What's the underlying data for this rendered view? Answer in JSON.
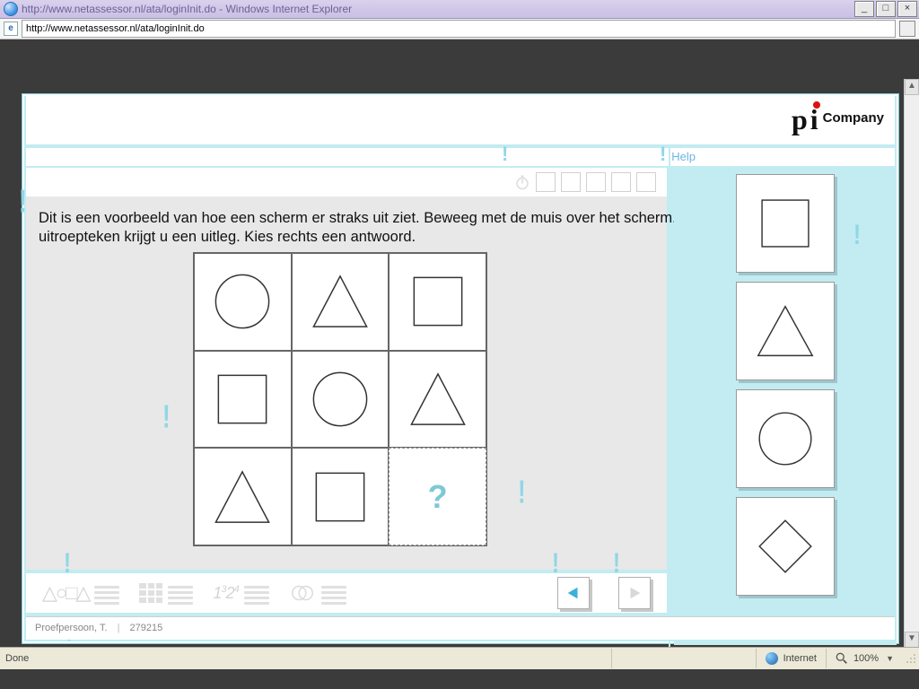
{
  "window": {
    "title": "http://www.netassessor.nl/ata/loginInit.do - Windows Internet Explorer",
    "url": "http://www.netassessor.nl/ata/loginInit.do"
  },
  "brand": {
    "company_suffix": "Company"
  },
  "nav": {
    "help_label": "Help"
  },
  "question": {
    "instruction": "Dit is een voorbeeld van hoe een scherm er straks uit ziet. Beweeg met de muis over het scherm. Bij elk uitroepteken krijgt u een uitleg. Kies rechts een antwoord.",
    "grid": [
      [
        "circle",
        "triangle",
        "square"
      ],
      [
        "square",
        "circle",
        "triangle"
      ],
      [
        "triangle",
        "square",
        "?"
      ]
    ],
    "missing_symbol": "?"
  },
  "answers": {
    "options": [
      "square",
      "triangle",
      "circle",
      "diamond"
    ]
  },
  "toolbar": {
    "shapes_label": "△○□△",
    "sequence_label": "1³₂⁴"
  },
  "footer": {
    "user_label": "Proefpersoon, T.",
    "separator": "|",
    "code": "279215"
  },
  "status": {
    "left": "Done",
    "zone": "Internet",
    "zoom": "100%"
  }
}
